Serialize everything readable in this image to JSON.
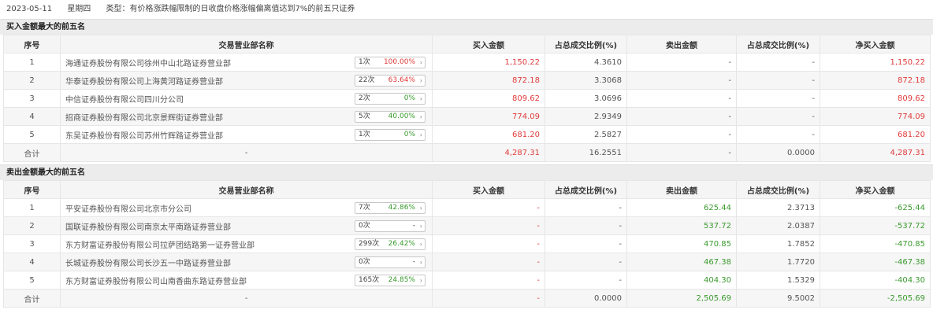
{
  "header": {
    "date": "2023-05-11",
    "weekday": "星期四",
    "type_text": "类型：有价格涨跌幅限制的日收盘价格涨幅偏离值达到7%的前五只证券"
  },
  "columns": [
    "序号",
    "交易营业部名称",
    "买入金额",
    "占总成交比例(%)",
    "卖出金额",
    "占总成交比例(%)",
    "净买入金额"
  ],
  "buy_section": {
    "title": "买入金额最大的前五名",
    "rows": [
      {
        "idx": "1",
        "name": "海通证券股份有限公司徐州中山北路证券营业部",
        "count": "1次",
        "pct": "100.00%",
        "pct_color": "red",
        "buy": "1,150.22",
        "buy_ratio": "4.3610",
        "sell": "-",
        "sell_ratio": "-",
        "net": "1,150.22"
      },
      {
        "idx": "2",
        "name": "华泰证券股份有限公司上海黄河路证券营业部",
        "count": "22次",
        "pct": "63.64%",
        "pct_color": "red",
        "buy": "872.18",
        "buy_ratio": "3.3068",
        "sell": "-",
        "sell_ratio": "-",
        "net": "872.18"
      },
      {
        "idx": "3",
        "name": "中信证券股份有限公司四川分公司",
        "count": "2次",
        "pct": "0%",
        "pct_color": "green",
        "buy": "809.62",
        "buy_ratio": "3.0696",
        "sell": "-",
        "sell_ratio": "-",
        "net": "809.62"
      },
      {
        "idx": "4",
        "name": "招商证券股份有限公司北京景辉街证券营业部",
        "count": "5次",
        "pct": "40.00%",
        "pct_color": "green",
        "buy": "774.09",
        "buy_ratio": "2.9349",
        "sell": "-",
        "sell_ratio": "-",
        "net": "774.09"
      },
      {
        "idx": "5",
        "name": "东吴证券股份有限公司苏州竹辉路证券营业部",
        "count": "1次",
        "pct": "0%",
        "pct_color": "green",
        "buy": "681.20",
        "buy_ratio": "2.5827",
        "sell": "-",
        "sell_ratio": "-",
        "net": "681.20"
      }
    ],
    "total": {
      "label": "合计",
      "name": "-",
      "buy": "4,287.31",
      "buy_ratio": "16.2551",
      "sell": "-",
      "sell_ratio": "0.0000",
      "net": "4,287.31"
    }
  },
  "sell_section": {
    "title": "卖出金额最大的前五名",
    "rows": [
      {
        "idx": "1",
        "name": "平安证券股份有限公司北京市分公司",
        "count": "7次",
        "pct": "42.86%",
        "pct_color": "green",
        "buy": "-",
        "buy_ratio": "-",
        "sell": "625.44",
        "sell_ratio": "2.3713",
        "net": "-625.44"
      },
      {
        "idx": "2",
        "name": "国联证券股份有限公司南京太平南路证券营业部",
        "count": "0次",
        "pct": "-",
        "pct_color": "gray",
        "buy": "-",
        "buy_ratio": "-",
        "sell": "537.72",
        "sell_ratio": "2.0387",
        "net": "-537.72"
      },
      {
        "idx": "3",
        "name": "东方财富证券股份有限公司拉萨团结路第一证券营业部",
        "count": "299次",
        "pct": "26.42%",
        "pct_color": "green",
        "buy": "-",
        "buy_ratio": "-",
        "sell": "470.85",
        "sell_ratio": "1.7852",
        "net": "-470.85"
      },
      {
        "idx": "4",
        "name": "长城证券股份有限公司长沙五一中路证券营业部",
        "count": "0次",
        "pct": "-",
        "pct_color": "gray",
        "buy": "-",
        "buy_ratio": "-",
        "sell": "467.38",
        "sell_ratio": "1.7720",
        "net": "-467.38"
      },
      {
        "idx": "5",
        "name": "东方财富证券股份有限公司山南香曲东路证券营业部",
        "count": "165次",
        "pct": "24.85%",
        "pct_color": "green",
        "buy": "-",
        "buy_ratio": "-",
        "sell": "404.30",
        "sell_ratio": "1.5329",
        "net": "-404.30"
      }
    ],
    "total": {
      "label": "合计",
      "name": "-",
      "buy": "-",
      "buy_ratio": "0.0000",
      "sell": "2,505.69",
      "sell_ratio": "9.5002",
      "net": "-2,505.69"
    }
  }
}
